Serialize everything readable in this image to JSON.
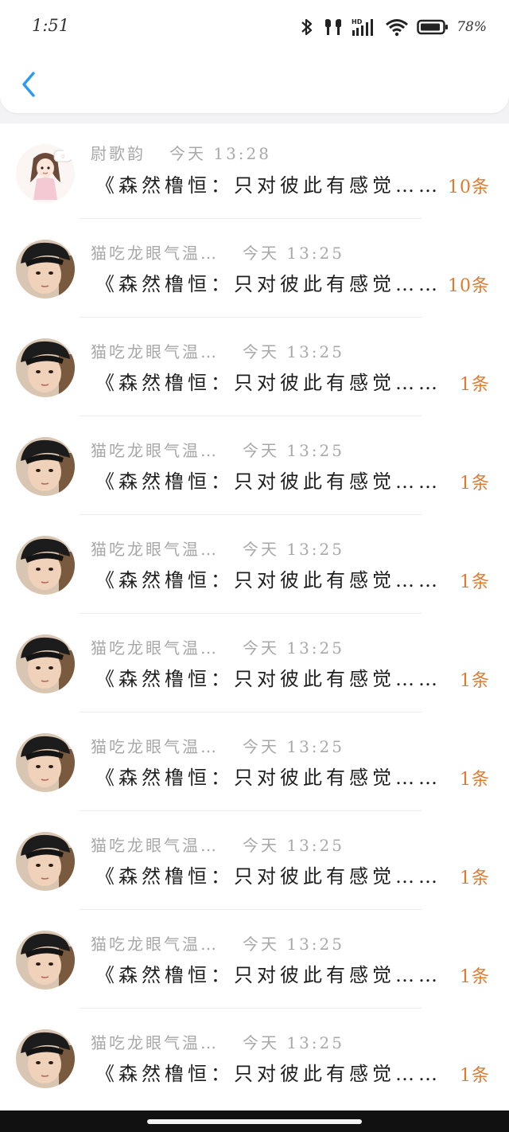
{
  "status_bar": {
    "time": "1:51",
    "battery": "78%",
    "icons": [
      "bluetooth-icon",
      "earbuds-icon",
      "hd-signal-icon",
      "wifi-icon",
      "battery-icon"
    ]
  },
  "header": {
    "back_icon": "chevron-left-icon",
    "accent_color": "#2b9af3"
  },
  "messages": [
    {
      "name": "尉歌韵",
      "time": "今天 13:28",
      "text": "《森然橹恒：只对彼此有感觉……",
      "count": "10条",
      "avatar": "cartoon-girl"
    },
    {
      "name": "猫吃龙眼气温…",
      "time": "今天 13:25",
      "text": "《森然橹恒：只对彼此有感觉……",
      "count": "10条",
      "avatar": "boy-photo"
    },
    {
      "name": "猫吃龙眼气温…",
      "time": "今天 13:25",
      "text": "《森然橹恒：只对彼此有感觉……",
      "count": "1条",
      "avatar": "boy-photo"
    },
    {
      "name": "猫吃龙眼气温…",
      "time": "今天 13:25",
      "text": "《森然橹恒：只对彼此有感觉……",
      "count": "1条",
      "avatar": "boy-photo"
    },
    {
      "name": "猫吃龙眼气温…",
      "time": "今天 13:25",
      "text": "《森然橹恒：只对彼此有感觉……",
      "count": "1条",
      "avatar": "boy-photo"
    },
    {
      "name": "猫吃龙眼气温…",
      "time": "今天 13:25",
      "text": "《森然橹恒：只对彼此有感觉……",
      "count": "1条",
      "avatar": "boy-photo"
    },
    {
      "name": "猫吃龙眼气温…",
      "time": "今天 13:25",
      "text": "《森然橹恒：只对彼此有感觉……",
      "count": "1条",
      "avatar": "boy-photo"
    },
    {
      "name": "猫吃龙眼气温…",
      "time": "今天 13:25",
      "text": "《森然橹恒：只对彼此有感觉……",
      "count": "1条",
      "avatar": "boy-photo"
    },
    {
      "name": "猫吃龙眼气温…",
      "time": "今天 13:25",
      "text": "《森然橹恒：只对彼此有感觉……",
      "count": "1条",
      "avatar": "boy-photo"
    },
    {
      "name": "猫吃龙眼气温…",
      "time": "今天 13:25",
      "text": "《森然橹恒：只对彼此有感觉……",
      "count": "1条",
      "avatar": "boy-photo"
    }
  ],
  "colors": {
    "count": "#e07a2e",
    "meta": "#a8a8a8",
    "text": "#1f1f1f"
  }
}
